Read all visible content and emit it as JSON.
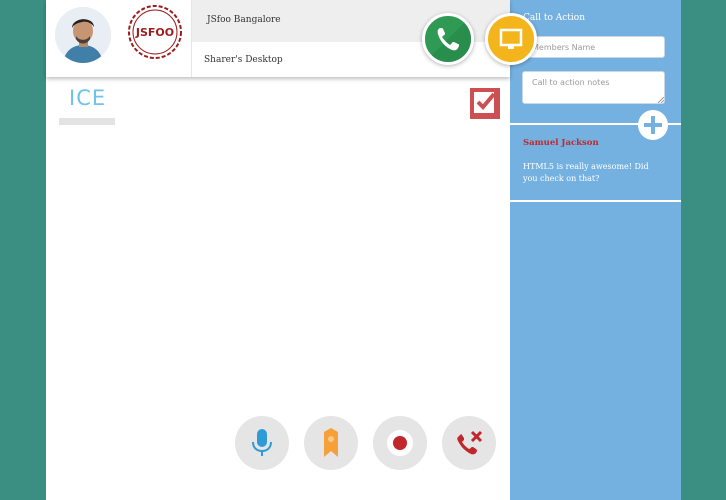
{
  "header": {
    "event_title": "JSfoo Bangalore",
    "screen_title": "Sharer's Desktop",
    "logo_text": "JSFOO"
  },
  "main": {
    "ice_label": "ICE"
  },
  "sidebar": {
    "cta_label": "Call to Action",
    "members_placeholder": "Members Name",
    "notes_placeholder": "Call to action notes",
    "message": {
      "author": "Samuel Jackson",
      "text": "HTML5 is really awesome! Did you check on that?"
    }
  },
  "colors": {
    "background": "#3a8f82",
    "sidebar": "#75b1e0",
    "call_green": "#2f9a54",
    "screen_yellow": "#f3b51b",
    "mic_blue": "#2e9bd6",
    "bookmark_orange": "#f5a03a",
    "record_red": "#c0272d",
    "author_red": "#c0272d",
    "ice_blue": "#6ec3e8"
  },
  "icons": [
    "phone-icon",
    "screen-share-icon",
    "checkbox-checked-icon",
    "microphone-icon",
    "bookmark-icon",
    "record-icon",
    "hangup-icon",
    "plus-icon"
  ]
}
